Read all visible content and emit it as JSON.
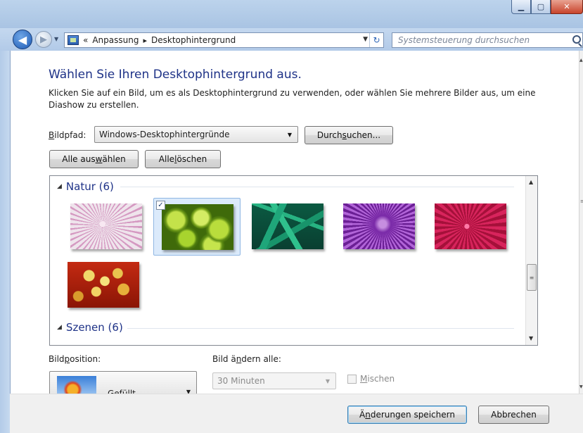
{
  "window": {
    "minimize_icon": "minimize-icon",
    "maximize_icon": "maximize-icon",
    "close_icon": "close-icon"
  },
  "nav": {
    "breadcrumb_overflow": "«",
    "crumb1": "Anpassung",
    "crumb2": "Desktophintergrund",
    "crumb_sep": "▸",
    "search_placeholder": "Systemsteuerung durchsuchen"
  },
  "page": {
    "title": "Wählen Sie Ihren Desktophintergrund aus.",
    "instructions": "Klicken Sie auf ein Bild, um es als Desktophintergrund zu verwenden, oder wählen Sie mehrere Bilder aus, um eine Diashow zu erstellen."
  },
  "picture_path": {
    "label_prefix": "",
    "label_accel": "B",
    "label_rest": "ildpfad:",
    "value": "Windows-Desktophintergründe",
    "browse_pre": "Durch",
    "browse_accel": "s",
    "browse_post": "uchen..."
  },
  "selection": {
    "select_all_pre": "Alle aus",
    "select_all_accel": "w",
    "select_all_post": "ählen",
    "clear_all_pre": "Alle ",
    "clear_all_accel": "l",
    "clear_all_post": "öschen"
  },
  "groups": [
    {
      "name": "Natur (6)",
      "images": [
        "dandelion-image",
        "green-succulent-image",
        "green-leaves-image",
        "purple-thistle-image",
        "red-dahlia-image",
        "yellow-petals-image"
      ],
      "selected_index": 1
    },
    {
      "name": "Szenen (6)"
    }
  ],
  "position": {
    "label_pre": "Bild",
    "label_accel": "p",
    "label_post": "osition:",
    "value": "Gefüllt"
  },
  "interval": {
    "label_pre": "Bild ä",
    "label_accel": "n",
    "label_post": "dern alle:",
    "value": "30 Minuten",
    "shuffle_accel": "M",
    "shuffle_rest": "ischen"
  },
  "footer": {
    "save_pre": "Ä",
    "save_accel": "n",
    "save_post": "derungen speichern",
    "cancel": "Abbrechen"
  }
}
